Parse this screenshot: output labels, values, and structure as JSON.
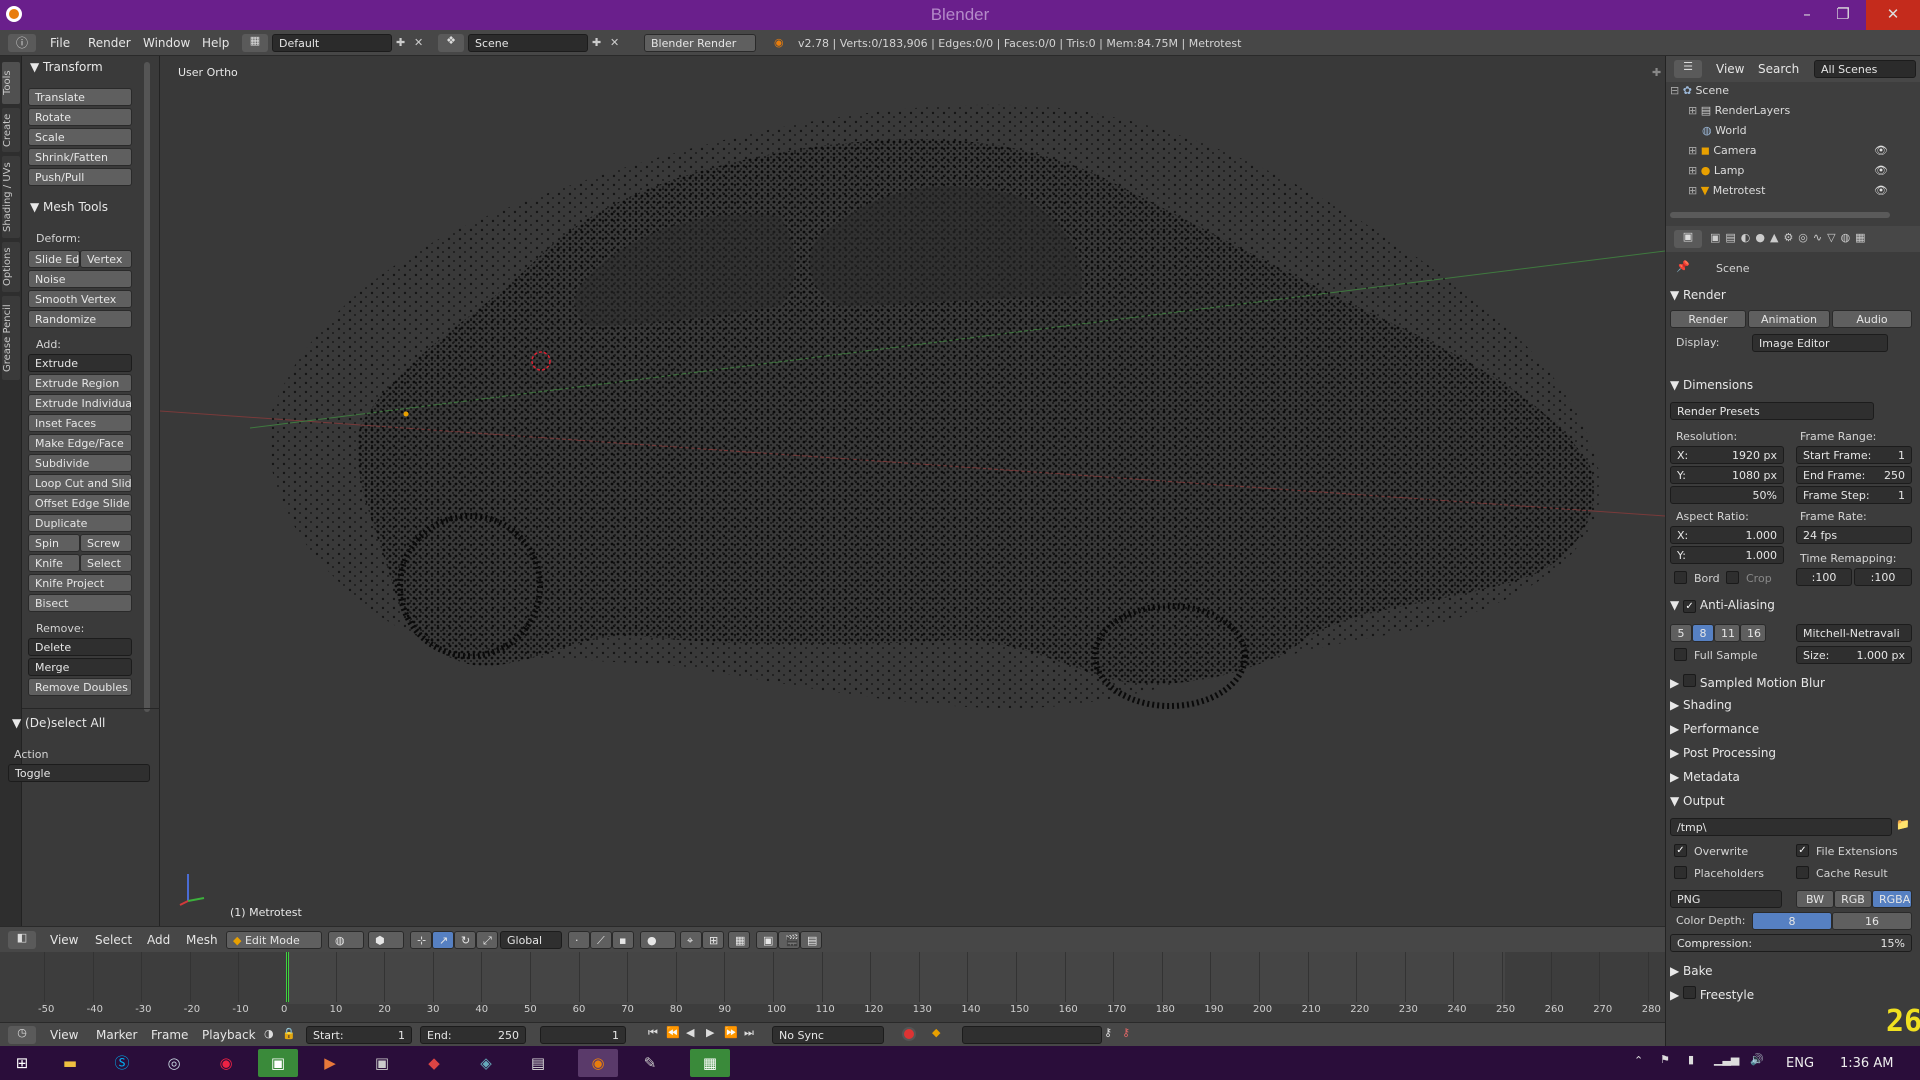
{
  "window": {
    "title": "Blender",
    "minimize": "–",
    "maximize": "❐",
    "close": "✕"
  },
  "infobar": {
    "menus": [
      "File",
      "Render",
      "Window",
      "Help"
    ],
    "layout": "Default",
    "scene": "Scene",
    "engine": "Blender Render",
    "stats": "v2.78 | Verts:0/183,906 | Edges:0/0 | Faces:0/0 | Tris:0 | Mem:84.75M | Metrotest"
  },
  "left_tabs": [
    "Tools",
    "Create",
    "Shading / UVs",
    "Options",
    "Grease Pencil"
  ],
  "toolshelf": {
    "transform_header": "Transform",
    "transform_tools": [
      "Translate",
      "Rotate",
      "Scale",
      "Shrink/Fatten",
      "Push/Pull"
    ],
    "mesh_tools_header": "Mesh Tools",
    "deform_label": "Deform:",
    "slide_edge": "Slide Ed",
    "vertex": "Vertex",
    "noise": "Noise",
    "smooth_vertex": "Smooth Vertex",
    "randomize": "Randomize",
    "add_label": "Add:",
    "extrude": "Extrude",
    "add_tools": [
      "Extrude Region",
      "Extrude Individual",
      "Inset Faces",
      "Make Edge/Face",
      "Subdivide",
      "Loop Cut and Slide",
      "Offset Edge Slide",
      "Duplicate"
    ],
    "spin": "Spin",
    "screw": "Screw",
    "knife": "Knife",
    "select": "Select",
    "knife_project": "Knife Project",
    "bisect": "Bisect",
    "remove_label": "Remove:",
    "delete": "Delete",
    "merge": "Merge",
    "remove_doubles": "Remove Doubles",
    "deselect_header": "(De)select All",
    "action_label": "Action",
    "action_value": "Toggle"
  },
  "viewport": {
    "view_label": "User Ortho",
    "object_label": "(1) Metrotest"
  },
  "viewport_header": {
    "menus": [
      "View",
      "Select",
      "Add",
      "Mesh"
    ],
    "mode": "Edit Mode",
    "orientation": "Global"
  },
  "timeline": {
    "ticks": [
      "-50",
      "-40",
      "-30",
      "-20",
      "-10",
      "0",
      "10",
      "20",
      "30",
      "40",
      "50",
      "60",
      "70",
      "80",
      "90",
      "100",
      "110",
      "120",
      "130",
      "140",
      "150",
      "160",
      "170",
      "180",
      "190",
      "200",
      "210",
      "220",
      "230",
      "240",
      "250",
      "260",
      "270",
      "280"
    ],
    "current_frame_marker": 0
  },
  "timeline_header": {
    "menus": [
      "View",
      "Marker",
      "Frame",
      "Playback"
    ],
    "start_label": "Start:",
    "start": "1",
    "end_label": "End:",
    "end": "250",
    "current": "1",
    "sync": "No Sync"
  },
  "outliner": {
    "menus": [
      "View",
      "Search"
    ],
    "filter": "All Scenes",
    "items": [
      "Scene",
      "RenderLayers",
      "World",
      "Camera",
      "Lamp",
      "Metrotest"
    ]
  },
  "properties": {
    "context": "Scene",
    "render_header": "Render",
    "render_btn": "Render",
    "animation_btn": "Animation",
    "audio_btn": "Audio",
    "display_label": "Display:",
    "display_value": "Image Editor",
    "dimensions_header": "Dimensions",
    "render_presets": "Render Presets",
    "resolution_label": "Resolution:",
    "res_x": "X:",
    "res_x_value": "1920 px",
    "res_y": "Y:",
    "res_y_value": "1080 px",
    "res_pct": "50%",
    "frame_range_label": "Frame Range:",
    "start_frame": "Start Frame:",
    "start_frame_value": "1",
    "end_frame": "End Frame:",
    "end_frame_value": "250",
    "frame_step": "Frame Step:",
    "frame_step_value": "1",
    "aspect_label": "Aspect Ratio:",
    "aspect_x": "X:",
    "aspect_x_value": "1.000",
    "aspect_y": "Y:",
    "aspect_y_value": "1.000",
    "frame_rate_label": "Frame Rate:",
    "frame_rate": "24 fps",
    "time_remap_label": "Time Remapping:",
    "remap_old": ":100",
    "remap_new": ":100",
    "bord": "Bord",
    "crop": "Crop",
    "aa_header": "Anti-Aliasing",
    "aa_samples": [
      "5",
      "8",
      "11",
      "16"
    ],
    "aa_filter": "Mitchell-Netravali",
    "full_sample": "Full Sample",
    "size_label": "Size:",
    "size_value": "1.000 px",
    "motion_blur": "Sampled Motion Blur",
    "shading": "Shading",
    "performance": "Performance",
    "post_processing": "Post Processing",
    "metadata": "Metadata",
    "output_header": "Output",
    "output_path": "/tmp\\",
    "overwrite": "Overwrite",
    "file_extensions": "File Extensions",
    "placeholders": "Placeholders",
    "cache_result": "Cache Result",
    "format": "PNG",
    "bw": "BW",
    "rgb": "RGB",
    "rgba": "RGBA",
    "color_depth_label": "Color Depth:",
    "depth_8": "8",
    "depth_16": "16",
    "compression_label": "Compression:",
    "compression_value": "15%",
    "bake": "Bake",
    "freestyle": "Freestyle"
  },
  "fps_overlay": "26",
  "taskbar": {
    "lang": "ENG",
    "time": "1:36 AM"
  },
  "colors": {
    "accent_blue": "#5680c2",
    "title_purple": "#6a1f8c",
    "taskbar": "#2a0d3a"
  }
}
